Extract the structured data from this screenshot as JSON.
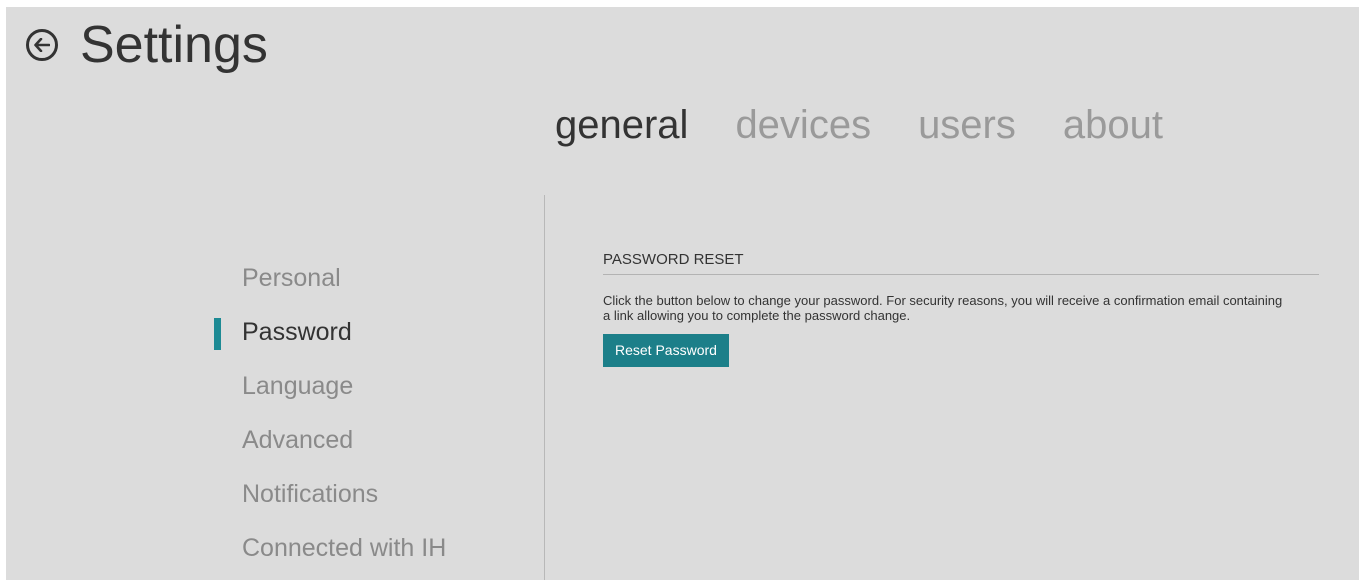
{
  "header": {
    "title": "Settings",
    "back_icon": "arrow-left-circle-icon"
  },
  "tabs": [
    {
      "label": "general",
      "active": true
    },
    {
      "label": "devices",
      "active": false
    },
    {
      "label": "users",
      "active": false
    },
    {
      "label": "about",
      "active": false
    }
  ],
  "sidebar": {
    "items": [
      {
        "label": "Personal",
        "active": false
      },
      {
        "label": "Password",
        "active": true
      },
      {
        "label": "Language",
        "active": false
      },
      {
        "label": "Advanced",
        "active": false
      },
      {
        "label": "Notifications",
        "active": false
      },
      {
        "label": "Connected with IH",
        "active": false
      }
    ]
  },
  "password_reset": {
    "section_title": "PASSWORD RESET",
    "description": "Click the button below to change your password. For security reasons, you will receive a confirmation email containing a link allowing you to complete the password change.",
    "button_label": "Reset Password"
  },
  "colors": {
    "background": "#dcdcdc",
    "accent": "#1c7f89",
    "text_primary": "#333333",
    "text_muted": "#8a8a8a"
  }
}
